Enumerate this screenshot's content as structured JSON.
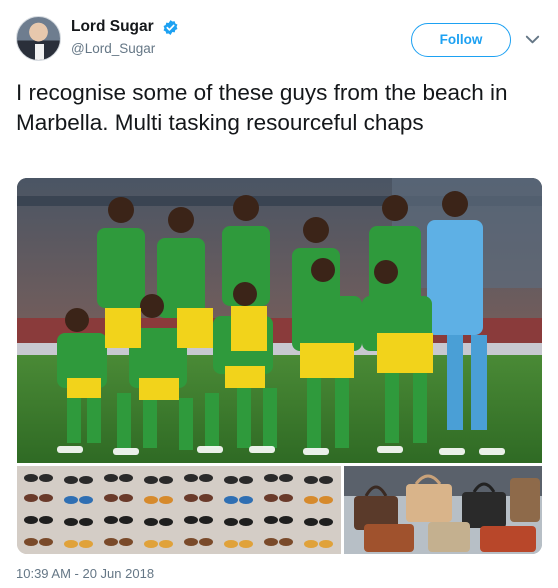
{
  "author": {
    "display_name": "Lord Sugar",
    "handle": "@Lord_Sugar",
    "verified_icon": "verified-badge-icon",
    "avatar_icon": "avatar"
  },
  "actions": {
    "follow_label": "Follow",
    "menu_icon": "chevron-down-icon"
  },
  "tweet": {
    "text": "I recognise some of these guys from the beach in Marbella. Multi tasking resourceful chaps",
    "timestamp": "10:39 AM - 20 Jun 2018"
  },
  "media": {
    "main_photo_icon": "team-photo",
    "bottom_left_icon": "sunglasses-stall-photo",
    "bottom_right_icon": "handbags-stall-photo"
  },
  "colors": {
    "accent": "#1da1f2",
    "text": "#14171a",
    "secondary": "#657786"
  }
}
